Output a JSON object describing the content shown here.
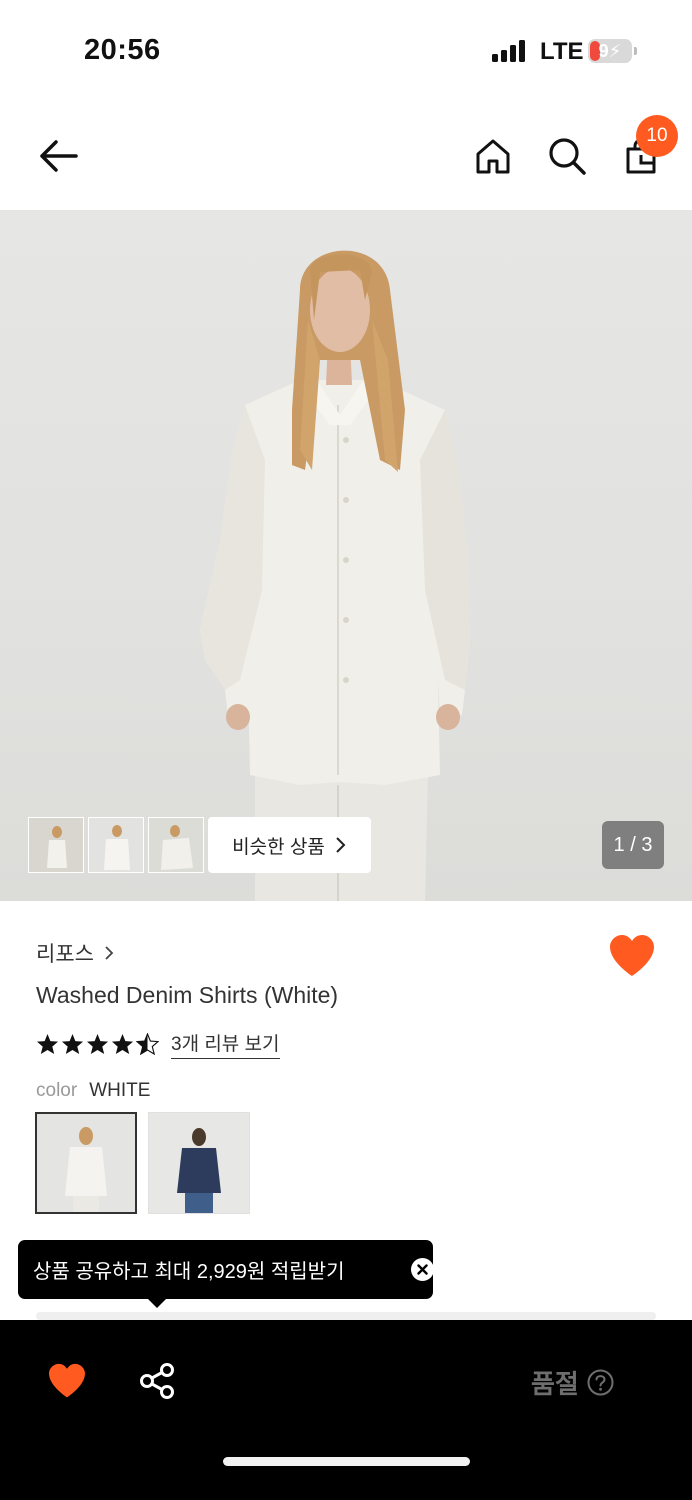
{
  "status_bar": {
    "time": "20:56",
    "network": "LTE",
    "battery": "9"
  },
  "nav": {
    "icons": [
      "back-arrow-icon",
      "home-icon",
      "search-icon",
      "shopping-bag-icon"
    ],
    "cart_count": "10"
  },
  "gallery": {
    "similar_label": "비슷한 상품",
    "page_indicator": "1 / 3"
  },
  "product": {
    "brand": "리포스",
    "name": "Washed Denim Shirts (White)",
    "rating": 4.5,
    "review_link": "3개 리뷰 보기",
    "color_label": "color",
    "color_value": "WHITE"
  },
  "tooltip": {
    "text": "상품 공유하고 최대 2,929원 적립받기"
  },
  "bottom_bar": {
    "status_label": "품절"
  },
  "colors": {
    "accent": "#ff5a1f",
    "bottom_bar_bg": "#000000"
  }
}
